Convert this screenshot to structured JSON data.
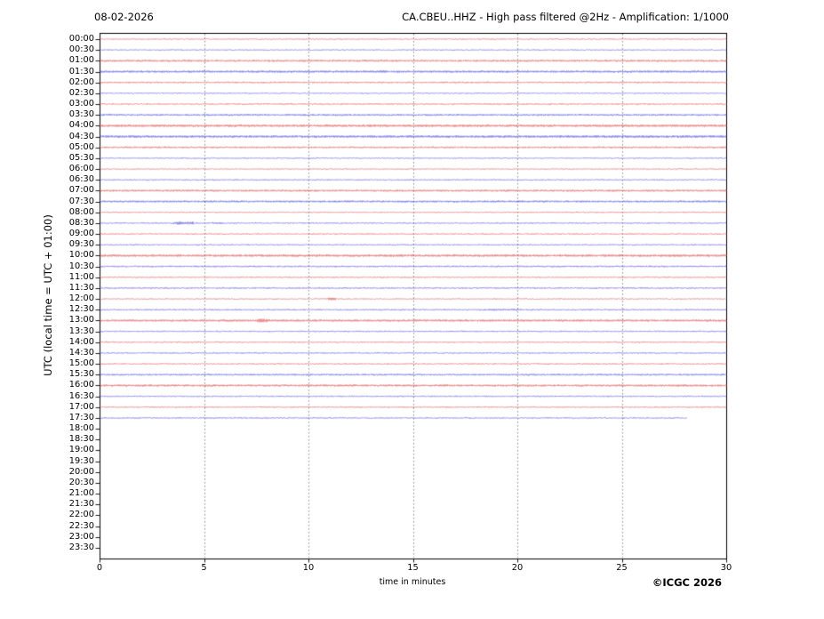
{
  "header": {
    "date_label": "08-02-2026",
    "title": "CA.CBEU..HHZ - High pass filtered @2Hz - Amplification: 1/1000"
  },
  "footer": {
    "copyright": "©ICGC 2026"
  },
  "chart_data": {
    "type": "line",
    "variant": "helicorder",
    "title": "CA.CBEU..HHZ - High pass filtered @2Hz - Amplification: 1/1000",
    "date": "08-02-2026",
    "station": "CA.CBEU..HHZ",
    "filter": "High pass filtered @2Hz",
    "amplification": "1/1000",
    "xlabel": "time in minutes",
    "ylabel": "UTC (local time = UTC + 01:00)",
    "xlim": [
      0,
      30
    ],
    "x_ticks": [
      0,
      5,
      10,
      15,
      20,
      25,
      30
    ],
    "grid_minutes": [
      5,
      10,
      15,
      20,
      25
    ],
    "grid_style": "dotted",
    "minutes_per_row": 30,
    "colors": {
      "red": "#d83030",
      "blue": "#3030d8",
      "grid": "#777777",
      "axis": "#000000",
      "background": "#ffffff"
    },
    "rows": [
      {
        "label": "00:00",
        "has_trace": true,
        "color": "red",
        "noise": 0.45,
        "end_minute": 30,
        "events": []
      },
      {
        "label": "00:30",
        "has_trace": true,
        "color": "blue",
        "noise": 0.45,
        "end_minute": 30,
        "events": []
      },
      {
        "label": "01:00",
        "has_trace": true,
        "color": "red",
        "noise": 0.8,
        "end_minute": 30,
        "events": []
      },
      {
        "label": "01:30",
        "has_trace": true,
        "color": "blue",
        "noise": 0.9,
        "end_minute": 30,
        "events": []
      },
      {
        "label": "02:00",
        "has_trace": true,
        "color": "red",
        "noise": 0.6,
        "end_minute": 30,
        "events": []
      },
      {
        "label": "02:30",
        "has_trace": true,
        "color": "blue",
        "noise": 0.45,
        "end_minute": 30,
        "events": []
      },
      {
        "label": "03:00",
        "has_trace": true,
        "color": "red",
        "noise": 0.55,
        "end_minute": 30,
        "events": []
      },
      {
        "label": "03:30",
        "has_trace": true,
        "color": "blue",
        "noise": 0.75,
        "end_minute": 30,
        "events": []
      },
      {
        "label": "04:00",
        "has_trace": true,
        "color": "red",
        "noise": 1.0,
        "end_minute": 30,
        "events": []
      },
      {
        "label": "04:30",
        "has_trace": true,
        "color": "blue",
        "noise": 1.0,
        "end_minute": 30,
        "events": []
      },
      {
        "label": "05:00",
        "has_trace": true,
        "color": "red",
        "noise": 0.7,
        "end_minute": 30,
        "events": []
      },
      {
        "label": "05:30",
        "has_trace": true,
        "color": "blue",
        "noise": 0.45,
        "end_minute": 30,
        "events": []
      },
      {
        "label": "06:00",
        "has_trace": true,
        "color": "red",
        "noise": 0.45,
        "end_minute": 30,
        "events": []
      },
      {
        "label": "06:30",
        "has_trace": true,
        "color": "blue",
        "noise": 0.5,
        "end_minute": 30,
        "events": []
      },
      {
        "label": "07:00",
        "has_trace": true,
        "color": "red",
        "noise": 0.8,
        "end_minute": 30,
        "events": []
      },
      {
        "label": "07:30",
        "has_trace": true,
        "color": "blue",
        "noise": 0.8,
        "end_minute": 30,
        "events": []
      },
      {
        "label": "08:00",
        "has_trace": true,
        "color": "red",
        "noise": 0.45,
        "end_minute": 30,
        "events": []
      },
      {
        "label": "08:30",
        "has_trace": true,
        "color": "blue",
        "noise": 0.5,
        "end_minute": 30,
        "events": [
          {
            "start_minute": 3.5,
            "end_minute": 4.5,
            "amplitude": 1.3
          },
          {
            "start_minute": 5.4,
            "end_minute": 5.9,
            "amplitude": 0.8
          }
        ]
      },
      {
        "label": "09:00",
        "has_trace": true,
        "color": "red",
        "noise": 0.5,
        "end_minute": 30,
        "events": []
      },
      {
        "label": "09:30",
        "has_trace": true,
        "color": "blue",
        "noise": 0.5,
        "end_minute": 30,
        "events": []
      },
      {
        "label": "10:00",
        "has_trace": true,
        "color": "red",
        "noise": 1.0,
        "end_minute": 30,
        "events": []
      },
      {
        "label": "10:30",
        "has_trace": true,
        "color": "blue",
        "noise": 0.6,
        "end_minute": 30,
        "events": []
      },
      {
        "label": "11:00",
        "has_trace": true,
        "color": "red",
        "noise": 0.5,
        "end_minute": 30,
        "events": []
      },
      {
        "label": "11:30",
        "has_trace": true,
        "color": "blue",
        "noise": 0.55,
        "end_minute": 30,
        "events": []
      },
      {
        "label": "12:00",
        "has_trace": true,
        "color": "red",
        "noise": 0.45,
        "end_minute": 30,
        "events": [
          {
            "start_minute": 10.9,
            "end_minute": 11.3,
            "amplitude": 1.2
          }
        ]
      },
      {
        "label": "12:30",
        "has_trace": true,
        "color": "blue",
        "noise": 0.55,
        "end_minute": 30,
        "events": [
          {
            "start_minute": 18.3,
            "end_minute": 20.2,
            "amplitude": 0.75
          }
        ]
      },
      {
        "label": "13:00",
        "has_trace": true,
        "color": "red",
        "noise": 0.9,
        "end_minute": 30,
        "events": [
          {
            "start_minute": 7.5,
            "end_minute": 8.1,
            "amplitude": 1.7
          }
        ]
      },
      {
        "label": "13:30",
        "has_trace": true,
        "color": "blue",
        "noise": 0.5,
        "end_minute": 30,
        "events": []
      },
      {
        "label": "14:00",
        "has_trace": true,
        "color": "red",
        "noise": 0.5,
        "end_minute": 30,
        "events": []
      },
      {
        "label": "14:30",
        "has_trace": true,
        "color": "blue",
        "noise": 0.5,
        "end_minute": 30,
        "events": []
      },
      {
        "label": "15:00",
        "has_trace": true,
        "color": "red",
        "noise": 0.5,
        "end_minute": 30,
        "events": []
      },
      {
        "label": "15:30",
        "has_trace": true,
        "color": "blue",
        "noise": 0.7,
        "end_minute": 30,
        "events": []
      },
      {
        "label": "16:00",
        "has_trace": true,
        "color": "red",
        "noise": 0.85,
        "end_minute": 30,
        "events": []
      },
      {
        "label": "16:30",
        "has_trace": true,
        "color": "blue",
        "noise": 0.5,
        "end_minute": 30,
        "events": []
      },
      {
        "label": "17:00",
        "has_trace": true,
        "color": "red",
        "noise": 0.5,
        "end_minute": 30,
        "events": []
      },
      {
        "label": "17:30",
        "has_trace": true,
        "color": "blue",
        "noise": 0.5,
        "end_minute": 28.1,
        "events": []
      },
      {
        "label": "18:00",
        "has_trace": false,
        "color": null,
        "noise": 0,
        "end_minute": 0,
        "events": []
      },
      {
        "label": "18:30",
        "has_trace": false,
        "color": null,
        "noise": 0,
        "end_minute": 0,
        "events": []
      },
      {
        "label": "19:00",
        "has_trace": false,
        "color": null,
        "noise": 0,
        "end_minute": 0,
        "events": []
      },
      {
        "label": "19:30",
        "has_trace": false,
        "color": null,
        "noise": 0,
        "end_minute": 0,
        "events": []
      },
      {
        "label": "20:00",
        "has_trace": false,
        "color": null,
        "noise": 0,
        "end_minute": 0,
        "events": []
      },
      {
        "label": "20:30",
        "has_trace": false,
        "color": null,
        "noise": 0,
        "end_minute": 0,
        "events": []
      },
      {
        "label": "21:00",
        "has_trace": false,
        "color": null,
        "noise": 0,
        "end_minute": 0,
        "events": []
      },
      {
        "label": "21:30",
        "has_trace": false,
        "color": null,
        "noise": 0,
        "end_minute": 0,
        "events": []
      },
      {
        "label": "22:00",
        "has_trace": false,
        "color": null,
        "noise": 0,
        "end_minute": 0,
        "events": []
      },
      {
        "label": "22:30",
        "has_trace": false,
        "color": null,
        "noise": 0,
        "end_minute": 0,
        "events": []
      },
      {
        "label": "23:00",
        "has_trace": false,
        "color": null,
        "noise": 0,
        "end_minute": 0,
        "events": []
      },
      {
        "label": "23:30",
        "has_trace": false,
        "color": null,
        "noise": 0,
        "end_minute": 0,
        "events": []
      }
    ]
  }
}
